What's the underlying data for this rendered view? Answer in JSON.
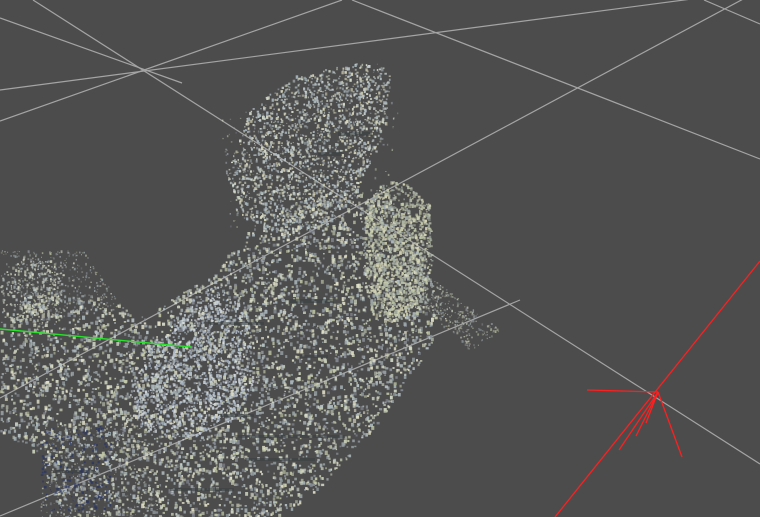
{
  "viewport": {
    "background_color": "#4c4c4c",
    "grid_color": "#a9a9a9",
    "point_cloud": {
      "palette": [
        "#d2d8c6",
        "#c9d0b9",
        "#b8c4c6",
        "#a9b6bb",
        "#e1e0c8",
        "#9aa3a6",
        "#8a909a",
        "#c3c9a8"
      ],
      "shadow_color": "#3b3f41",
      "accent_blue": "#2a3666"
    },
    "axes": {
      "x_color": "#ff1f1f",
      "y_color": "#29e02b"
    }
  }
}
